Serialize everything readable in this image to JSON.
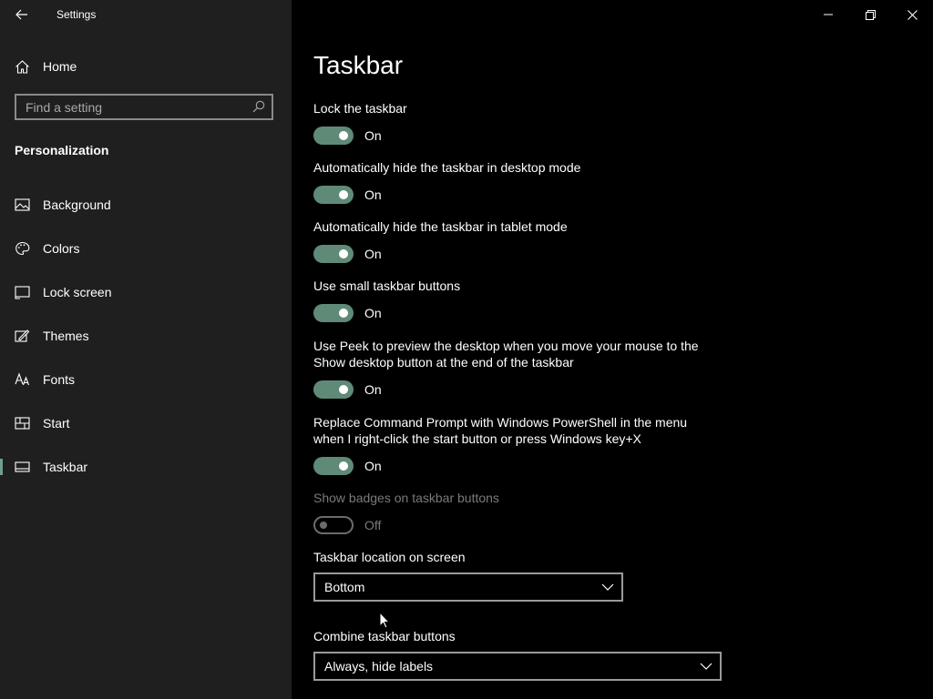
{
  "window": {
    "title": "Settings"
  },
  "sidebar": {
    "home_label": "Home",
    "search_placeholder": "Find a setting",
    "section_heading": "Personalization",
    "items": [
      {
        "label": "Background",
        "icon": "image-icon"
      },
      {
        "label": "Colors",
        "icon": "palette-icon"
      },
      {
        "label": "Lock screen",
        "icon": "lock-screen-icon"
      },
      {
        "label": "Themes",
        "icon": "themes-icon"
      },
      {
        "label": "Fonts",
        "icon": "fonts-icon"
      },
      {
        "label": "Start",
        "icon": "start-icon"
      },
      {
        "label": "Taskbar",
        "icon": "taskbar-icon",
        "selected": true
      }
    ]
  },
  "main": {
    "title": "Taskbar",
    "toggles": [
      {
        "label": "Lock the taskbar",
        "state": "On",
        "on": true
      },
      {
        "label": "Automatically hide the taskbar in desktop mode",
        "state": "On",
        "on": true
      },
      {
        "label": "Automatically hide the taskbar in tablet mode",
        "state": "On",
        "on": true
      },
      {
        "label": "Use small taskbar buttons",
        "state": "On",
        "on": true
      },
      {
        "label": "Use Peek to preview the desktop when you move your mouse to the Show desktop button at the end of the taskbar",
        "state": "On",
        "on": true
      },
      {
        "label": "Replace Command Prompt with Windows PowerShell in the menu when I right-click the start button or press Windows key+X",
        "state": "On",
        "on": true
      },
      {
        "label": "Show badges on taskbar buttons",
        "state": "Off",
        "on": false,
        "disabled": true
      }
    ],
    "location": {
      "label": "Taskbar location on screen",
      "value": "Bottom"
    },
    "combine": {
      "label": "Combine taskbar buttons",
      "value": "Always, hide labels"
    }
  },
  "colors": {
    "accent": "#5f8a78",
    "sidebar_bg": "#1f1f1f",
    "content_bg": "#000000"
  }
}
